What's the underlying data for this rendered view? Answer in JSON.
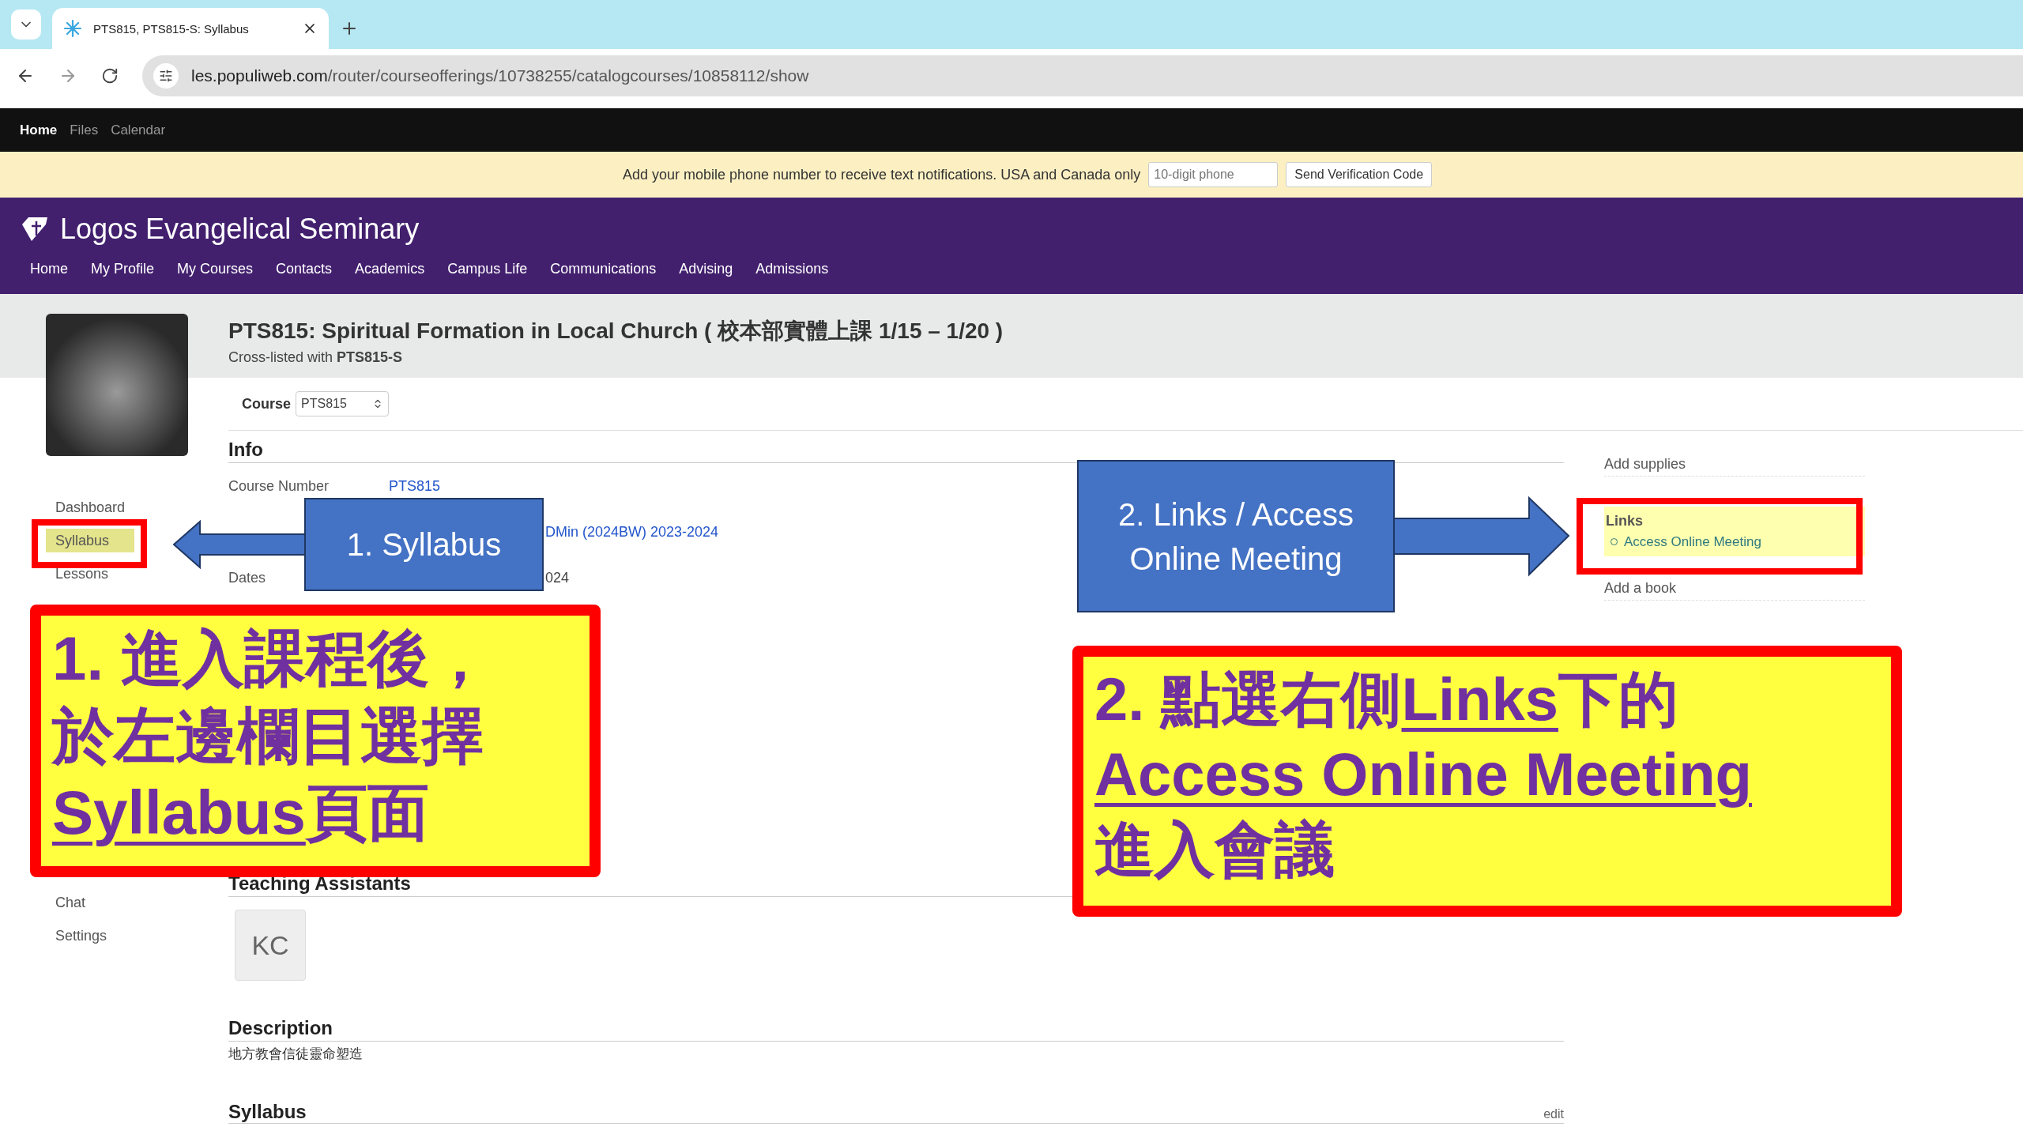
{
  "browser": {
    "tab_title": "PTS815, PTS815-S: Syllabus",
    "url_host": "les.populiweb.com",
    "url_path": "/router/courseofferings/10738255/catalogcourses/10858112/show"
  },
  "top_nav": [
    {
      "label": "Home",
      "selected": true
    },
    {
      "label": "Files",
      "selected": false
    },
    {
      "label": "Calendar",
      "selected": false
    }
  ],
  "notice": {
    "text": "Add your mobile phone number to receive text notifications. USA and Canada only",
    "placeholder": "10-digit phone",
    "button": "Send Verification Code"
  },
  "brand": "Logos Evangelical Seminary",
  "main_nav": [
    "Home",
    "My Profile",
    "My Courses",
    "Contacts",
    "Academics",
    "Campus Life",
    "Communications",
    "Advising",
    "Admissions"
  ],
  "course": {
    "title": "PTS815: Spiritual Formation in Local Church ( 校本部實體上課 1/15 – 1/20 )",
    "cross_listed": "Cross-listed with **PTS815-S**",
    "selector_label": "Course",
    "selector_value": "PTS815"
  },
  "sidebar": {
    "items_top": [
      {
        "label": "Dashboard",
        "selected": false
      },
      {
        "label": "Syllabus",
        "selected": true
      },
      {
        "label": "Lessons",
        "selected": false
      }
    ],
    "items_bottom": [
      {
        "label": "Chat",
        "selected": false
      },
      {
        "label": "Settings",
        "selected": false
      }
    ]
  },
  "info": {
    "heading": "Info",
    "rows": [
      {
        "kind": "full",
        "label": "Course Number",
        "value": "PTS815",
        "link": true
      },
      {
        "kind": "occluded",
        "value": "DMin (2024BW) 2023-2024",
        "link": true
      },
      {
        "kind": "offset",
        "label": "Dates",
        "value": "024",
        "link": false
      }
    ]
  },
  "teaching_assistants": {
    "heading": "Teaching Assistants",
    "initials": "KC"
  },
  "description": {
    "heading": "Description",
    "text": "地方教會信徒靈命塑造"
  },
  "syllabus": {
    "heading": "Syllabus",
    "edit": "edit"
  },
  "right_panel": {
    "add_supplies": "Add supplies",
    "links_heading": "Links",
    "links": [
      "Access Online Meeting"
    ],
    "add_book": "Add a book"
  },
  "annotations": {
    "callout_1": "1. Syllabus",
    "callout_2": "2. Links / Access Online Meeting",
    "note_1": [
      [
        {
          "text": "1. 進入課程後，",
          "underline": false
        }
      ],
      [
        {
          "text": "於左邊欄目選擇",
          "underline": false
        }
      ],
      [
        {
          "text": "Syllabus",
          "underline": true
        },
        {
          "text": "頁面",
          "underline": false
        }
      ]
    ],
    "note_2": [
      [
        {
          "text": "2. 點選右側",
          "underline": false
        },
        {
          "text": "Links",
          "underline": true
        },
        {
          "text": "下的",
          "underline": false
        }
      ],
      [
        {
          "text": "Access Online Meeting",
          "underline": true
        }
      ],
      [
        {
          "text": "進入會議",
          "underline": false
        }
      ]
    ]
  }
}
